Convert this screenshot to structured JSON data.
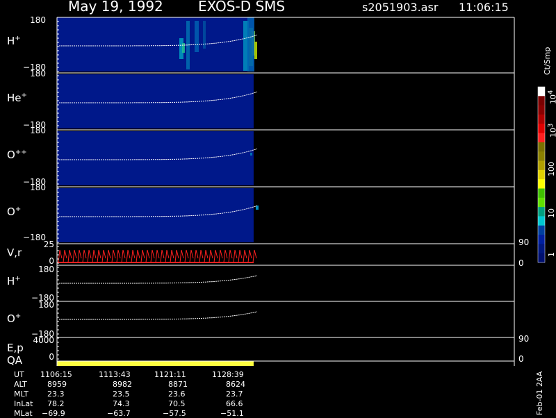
{
  "header": {
    "date": "May 19, 1992",
    "instrument": "EXOS-D SMS",
    "file": "s2051903.asr",
    "time": "11:06:15"
  },
  "colorbar": {
    "unit": "Ct/Smp",
    "ticks": [
      "10",
      "10",
      "100",
      "10",
      "1"
    ],
    "tick_exp": [
      "4",
      "3",
      "",
      "",
      ""
    ],
    "colors": [
      "#ffffff",
      "#7a0000",
      "#8a0000",
      "#b00000",
      "#e00000",
      "#ff2020",
      "#7a7000",
      "#8a8000",
      "#b0a000",
      "#e0d000",
      "#ffff00",
      "#40c000",
      "#60e000",
      "#00a080",
      "#00c8d0",
      "#0040a0",
      "#0020a0",
      "#001880",
      "#001070"
    ]
  },
  "panels": [
    {
      "label": "H",
      "sup": "+",
      "top": "180",
      "bottom": "−180"
    },
    {
      "label": "He",
      "sup": "+",
      "top": "180",
      "bottom": "−180"
    },
    {
      "label": "O",
      "sup": "++",
      "top": "180",
      "bottom": "−180"
    },
    {
      "label": "O",
      "sup": "+",
      "top": "180",
      "bottom": "−180"
    },
    {
      "label": "V,r",
      "sup": "",
      "top": "25",
      "bottom": "0",
      "right_top": "90",
      "right_bottom": "0"
    },
    {
      "label": "H",
      "sup": "+",
      "top": "180",
      "bottom": "−180"
    },
    {
      "label": "O",
      "sup": "+",
      "top": "180",
      "bottom": "−180"
    },
    {
      "label": "E,p",
      "sup": "",
      "top": "4000",
      "bottom": "0",
      "right_top": "90",
      "right_bottom": "0"
    },
    {
      "label": "QA",
      "sup": "",
      "top": "",
      "bottom": ""
    }
  ],
  "footer": {
    "rows": [
      {
        "name": "UT",
        "values": [
          "1106:15",
          "1113:43",
          "1121:11",
          "1128:39"
        ]
      },
      {
        "name": "ALT",
        "values": [
          "8959",
          "8982",
          "8871",
          "8624"
        ]
      },
      {
        "name": "MLT",
        "values": [
          "23.3",
          "23.5",
          "23.6",
          "23.7"
        ]
      },
      {
        "name": "InLat",
        "values": [
          "78.2",
          "74.3",
          "70.5",
          "66.6"
        ]
      },
      {
        "name": "MLat",
        "values": [
          "−69.9",
          "−63.7",
          "−57.5",
          "−51.1"
        ]
      }
    ],
    "stamp": "Feb-01 2AA"
  },
  "chart_data": {
    "type": "heatmap",
    "title": "May 19, 1992   EXOS-D SMS",
    "x_ticks_ut": [
      "1106:15",
      "1113:43",
      "1121:11",
      "1128:39"
    ],
    "data_end_fraction": 0.43,
    "qa_fill_color": "#ffff40",
    "background": "#00188a",
    "pitch_angle_range": [
      -180,
      180
    ]
  }
}
